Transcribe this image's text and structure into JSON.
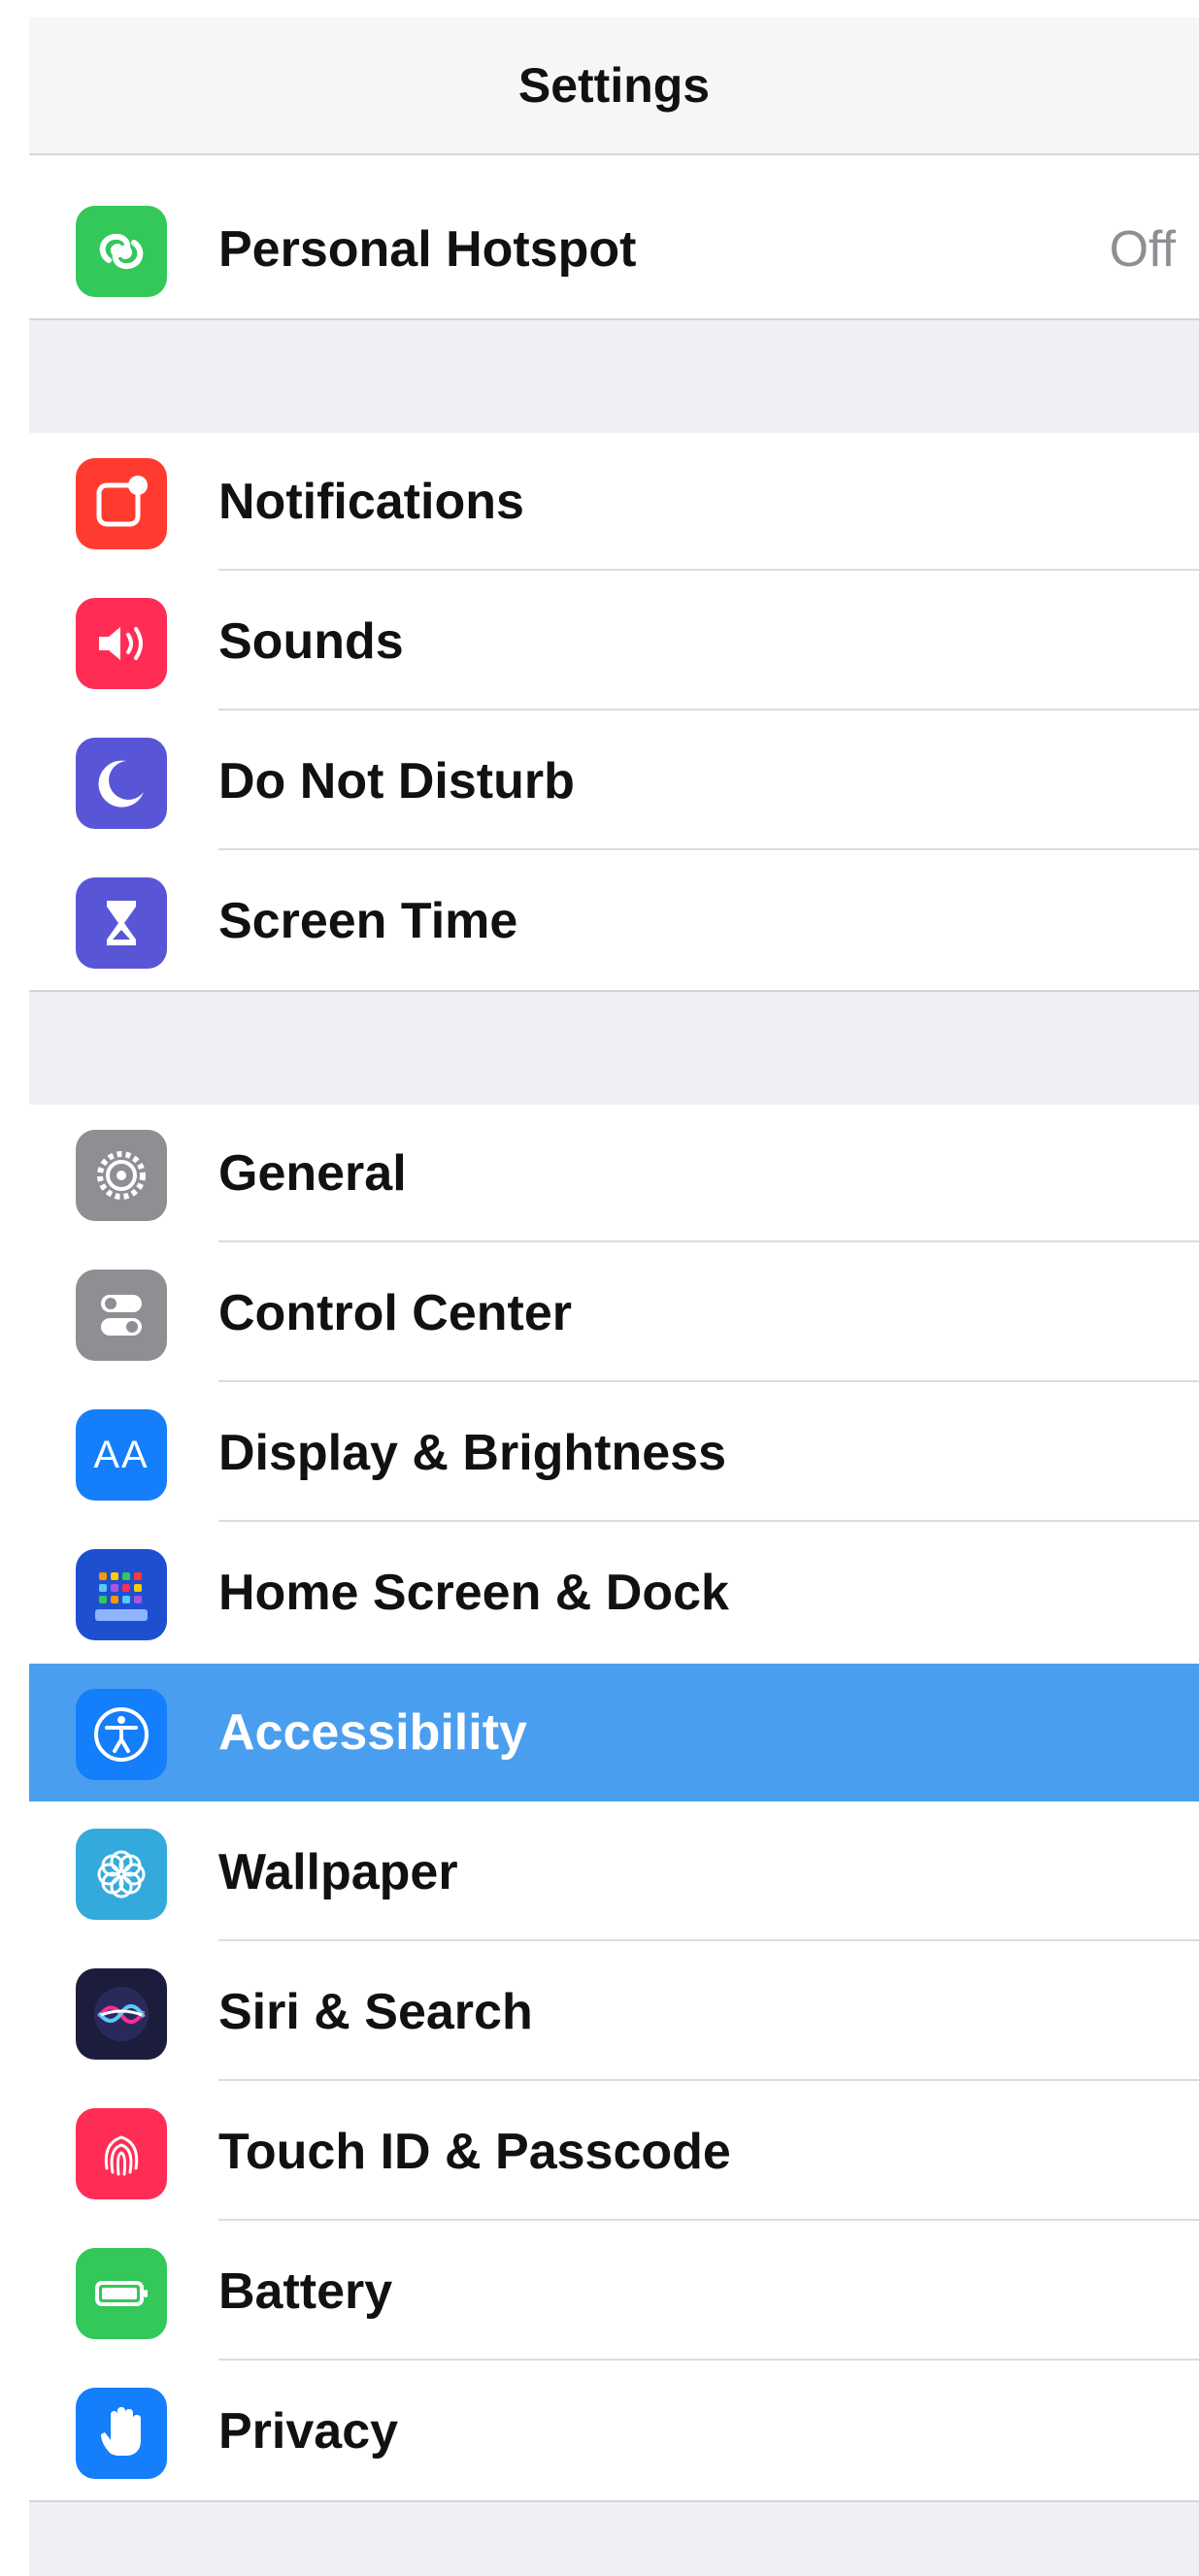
{
  "header": {
    "title": "Settings"
  },
  "colors": {
    "selected_row": "#4a9ef0",
    "hotspot": "#34c759",
    "notifications": "#ff3b30",
    "sounds": "#ff2d55",
    "do_not_disturb": "#5856d6",
    "screen_time": "#5856d6",
    "general": "#8e8e93",
    "control_center": "#8e8e93",
    "display": "#147efb",
    "home_screen": "#1f4fd1",
    "accessibility": "#147efb",
    "wallpaper": "#34aadc",
    "siri": "#1c1c3c",
    "touch_id": "#ff2d55",
    "battery": "#34c759",
    "privacy": "#147efb"
  },
  "groups": [
    {
      "items": [
        {
          "label": "Personal Hotspot",
          "value": "Off",
          "icon": "hotspot-icon"
        }
      ]
    },
    {
      "items": [
        {
          "label": "Notifications",
          "icon": "notifications-icon"
        },
        {
          "label": "Sounds",
          "icon": "sounds-icon"
        },
        {
          "label": "Do Not Disturb",
          "icon": "moon-icon"
        },
        {
          "label": "Screen Time",
          "icon": "hourglass-icon"
        }
      ]
    },
    {
      "items": [
        {
          "label": "General",
          "icon": "gear-icon"
        },
        {
          "label": "Control Center",
          "icon": "toggles-icon"
        },
        {
          "label": "Display & Brightness",
          "icon": "display-icon",
          "icon_text": "AA"
        },
        {
          "label": "Home Screen & Dock",
          "icon": "home-grid-icon"
        },
        {
          "label": "Accessibility",
          "icon": "accessibility-icon",
          "selected": true
        },
        {
          "label": "Wallpaper",
          "icon": "flower-icon"
        },
        {
          "label": "Siri & Search",
          "icon": "siri-icon"
        },
        {
          "label": "Touch ID & Passcode",
          "icon": "fingerprint-icon"
        },
        {
          "label": "Battery",
          "icon": "battery-icon"
        },
        {
          "label": "Privacy",
          "icon": "hand-icon"
        }
      ]
    }
  ]
}
